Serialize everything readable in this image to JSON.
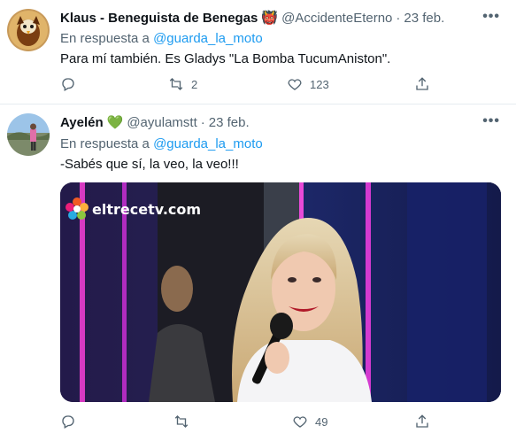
{
  "tweets": [
    {
      "name": "Klaus - Beneguista de Benegas",
      "emoji": "👹",
      "handle": "@AccidenteEterno",
      "separator": "·",
      "date": "23 feb.",
      "more": "•••",
      "replying_prefix": "En respuesta a",
      "replying_to": "@guarda_la_moto",
      "text": "Para mí también. Es Gladys \"La Bomba TucumAniston\".",
      "actions": {
        "reply_count": "",
        "retweet_count": "2",
        "like_count": "123"
      }
    },
    {
      "name": "Ayelén",
      "emoji": "💚",
      "handle": "@ayulamstt",
      "separator": "·",
      "date": "23 feb.",
      "more": "•••",
      "replying_prefix": "En respuesta a",
      "replying_to": "@guarda_la_moto",
      "text": "-Sabés que sí, la veo, la veo!!!",
      "media": {
        "watermark": "eltrecetv.com"
      },
      "actions": {
        "reply_count": "",
        "retweet_count": "",
        "like_count": "49"
      }
    }
  ],
  "colors": {
    "accent": "#1d9bf0",
    "secondary_text": "#536471",
    "primary_text": "#0f1419",
    "divider": "#e6ecf0"
  }
}
